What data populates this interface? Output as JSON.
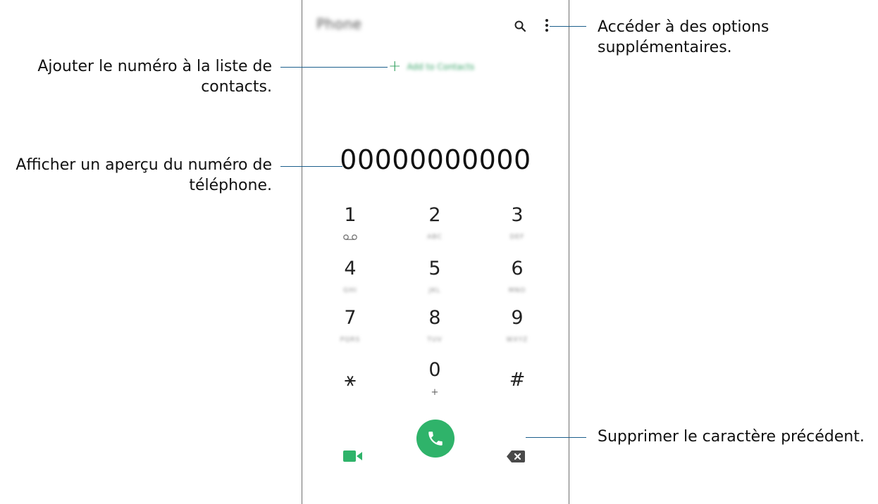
{
  "app": {
    "title": "Phone",
    "add_to_contacts": "Add to Contacts",
    "number": "00000000000"
  },
  "keypad": [
    {
      "digit": "1",
      "letters": "",
      "sub": ""
    },
    {
      "digit": "2",
      "letters": "ABC",
      "sub": ""
    },
    {
      "digit": "3",
      "letters": "DEF",
      "sub": ""
    },
    {
      "digit": "4",
      "letters": "GHI",
      "sub": ""
    },
    {
      "digit": "5",
      "letters": "JKL",
      "sub": ""
    },
    {
      "digit": "6",
      "letters": "MNO",
      "sub": ""
    },
    {
      "digit": "7",
      "letters": "PQRS",
      "sub": ""
    },
    {
      "digit": "8",
      "letters": "TUV",
      "sub": ""
    },
    {
      "digit": "9",
      "letters": "WXYZ",
      "sub": ""
    },
    {
      "digit": "⚹",
      "letters": "",
      "sub": ""
    },
    {
      "digit": "0",
      "letters": "",
      "sub": "+"
    },
    {
      "digit": "#",
      "letters": "",
      "sub": ""
    }
  ],
  "annotations": {
    "more_options": "Accéder à des options supplémentaires.",
    "add_contacts": "Ajouter le numéro à la liste de contacts.",
    "preview_number": "Afficher un aperçu du numéro de téléphone.",
    "delete_char": "Supprimer le caractère précédent."
  },
  "icons": {
    "search": "search-icon",
    "more": "more-vertical-icon",
    "voicemail": "voicemail-icon",
    "video_call": "video-camera-icon",
    "call": "phone-icon",
    "backspace": "backspace-icon"
  },
  "colors": {
    "accent_green": "#2fb36a",
    "callout_line": "#1c5f8c"
  }
}
